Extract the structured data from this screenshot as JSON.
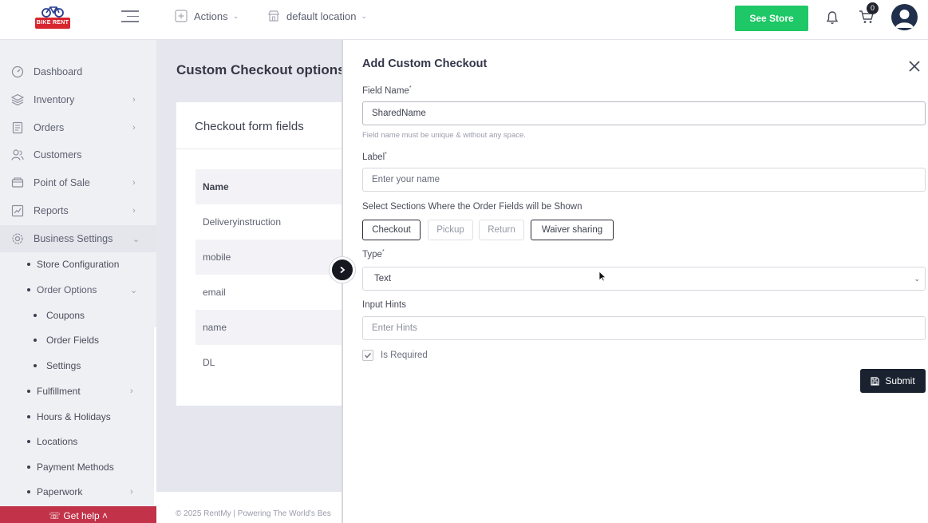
{
  "header": {
    "logo_text": "BIKE RENT",
    "actions_label": "Actions",
    "location_label": "default location",
    "see_store_label": "See Store",
    "cart_count": "0"
  },
  "sidebar": {
    "items": [
      {
        "label": "Dashboard",
        "icon": "dashboard-icon"
      },
      {
        "label": "Inventory",
        "icon": "layers-icon"
      },
      {
        "label": "Orders",
        "icon": "document-icon"
      },
      {
        "label": "Customers",
        "icon": "users-icon"
      },
      {
        "label": "Point of Sale",
        "icon": "pos-icon"
      },
      {
        "label": "Reports",
        "icon": "chart-icon"
      },
      {
        "label": "Business Settings",
        "icon": "gear-icon"
      }
    ],
    "sub_items": [
      {
        "label": "Store Configuration"
      },
      {
        "label": "Order Options"
      },
      {
        "label": "Coupons"
      },
      {
        "label": "Order Fields"
      },
      {
        "label": "Settings"
      },
      {
        "label": "Fulfillment"
      },
      {
        "label": "Hours & Holidays"
      },
      {
        "label": "Locations"
      },
      {
        "label": "Payment Methods"
      },
      {
        "label": "Paperwork"
      }
    ],
    "get_help_label": "Get help"
  },
  "main": {
    "page_title": "Custom Checkout options",
    "card_title": "Checkout form fields",
    "table_header": "Name",
    "rows": [
      "Deliveryinstruction",
      "mobile",
      "email",
      "name",
      "DL"
    ],
    "footer_text": "© 2025 RentMy | Powering The World's Bes"
  },
  "drawer": {
    "title": "Add Custom Checkout",
    "field_name_label": "Field Name",
    "field_name_value": "SharedName",
    "field_name_help": "Field name must be unique & without any space.",
    "label_label": "Label",
    "label_placeholder": "Enter your name",
    "sections_label": "Select Sections Where the Order Fields will be Shown",
    "sections": [
      {
        "label": "Checkout",
        "selected": true
      },
      {
        "label": "Pickup",
        "selected": false
      },
      {
        "label": "Return",
        "selected": false
      },
      {
        "label": "Waiver sharing",
        "selected": true
      }
    ],
    "type_label": "Type",
    "type_value": "Text",
    "hints_label": "Input Hints",
    "hints_placeholder": "Enter Hints",
    "is_required_label": "Is Required",
    "is_required_checked": true,
    "submit_label": "Submit",
    "required_mark": "*"
  },
  "colors": {
    "see_store": "#1ec866",
    "submit": "#1a2230",
    "get_help": "#c2334a",
    "logo_red": "#d8262f"
  }
}
